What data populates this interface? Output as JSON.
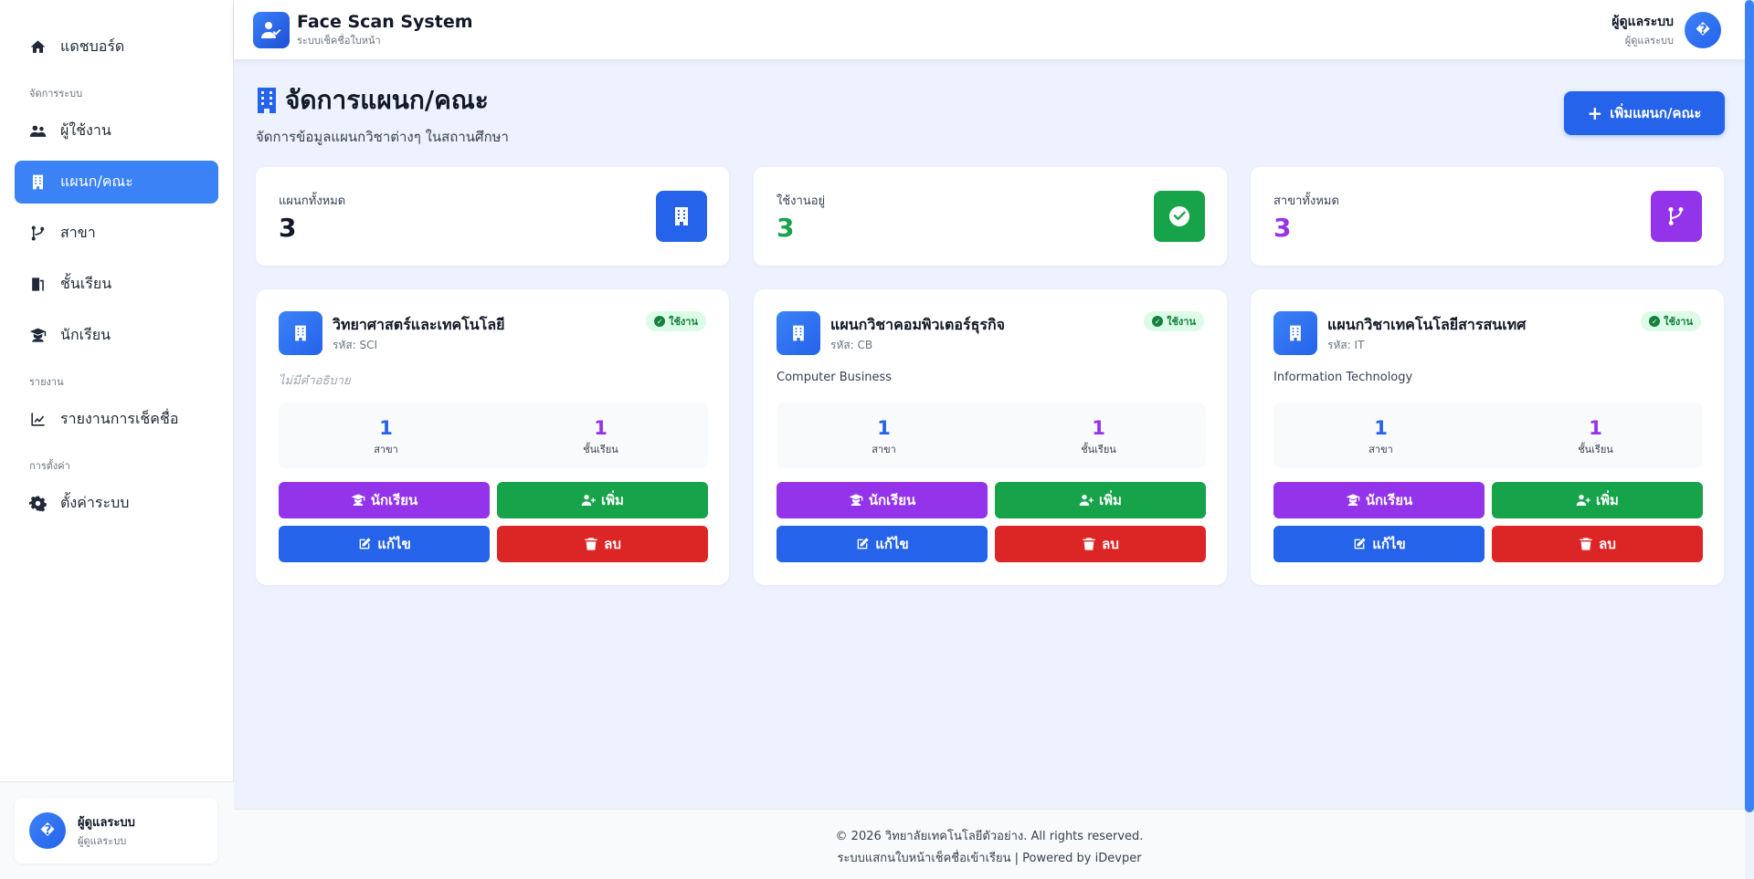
{
  "header": {
    "title": "Face Scan System",
    "subtitle": "ระบบเช็คชื่อใบหน้า",
    "user_name": "ผู้ดูแลระบบ",
    "user_role": "ผู้ดูแลระบบ",
    "avatar_glyph": "�"
  },
  "sidebar": {
    "items": [
      {
        "label": "แดชบอร์ด",
        "icon": "home-icon"
      },
      {
        "section": "จัดการระบบ"
      },
      {
        "label": "ผู้ใช้งาน",
        "icon": "users-icon"
      },
      {
        "label": "แผนก/คณะ",
        "icon": "building-icon",
        "active": true
      },
      {
        "label": "สาขา",
        "icon": "branch-icon"
      },
      {
        "label": "ชั้นเรียน",
        "icon": "door-icon"
      },
      {
        "label": "นักเรียน",
        "icon": "graduate-icon"
      },
      {
        "section": "รายงาน"
      },
      {
        "label": "รายงานการเช็คชื่อ",
        "icon": "chart-line-icon"
      },
      {
        "section": "การตั้งค่า"
      },
      {
        "label": "ตั้งค่าระบบ",
        "icon": "gear-icon"
      }
    ],
    "user_name": "ผู้ดูแลระบบ",
    "user_role": "ผู้ดูแลระบบ",
    "avatar_glyph": "�"
  },
  "page": {
    "title": "จัดการแผนก/คณะ",
    "subtitle": "จัดการข้อมูลแผนกวิชาต่างๆ ในสถานศึกษา",
    "add_button": "เพิ่มแผนก/คณะ"
  },
  "stats": [
    {
      "label": "แผนกทั้งหมด",
      "value": "3",
      "color": "#111827",
      "icon_bg": "#2563eb"
    },
    {
      "label": "ใช้งานอยู่",
      "value": "3",
      "color": "#16a34a",
      "icon_bg": "#16a34a"
    },
    {
      "label": "สาขาทั้งหมด",
      "value": "3",
      "color": "#9333ea",
      "icon_bg": "#9333ea"
    }
  ],
  "cards": [
    {
      "name": "วิทยาศาสตร์และเทคโนโลยี",
      "code": "รหัส: SCI",
      "status": "ใช้งาน",
      "description": "ไม่มีคำอธิบาย",
      "description_empty": true,
      "branches": "1",
      "branches_label": "สาขา",
      "classes": "1",
      "classes_label": "ชั้นเรียน"
    },
    {
      "name": "แผนกวิชาคอมพิวเตอร์ธุรกิจ",
      "code": "รหัส: CB",
      "status": "ใช้งาน",
      "description": "Computer Business",
      "description_empty": false,
      "branches": "1",
      "branches_label": "สาขา",
      "classes": "1",
      "classes_label": "ชั้นเรียน"
    },
    {
      "name": "แผนกวิชาเทคโนโลยีสารสนเทศ",
      "code": "รหัส: IT",
      "status": "ใช้งาน",
      "description": "Information Technology",
      "description_empty": false,
      "branches": "1",
      "branches_label": "สาขา",
      "classes": "1",
      "classes_label": "ชั้นเรียน"
    }
  ],
  "card_buttons": {
    "students": "นักเรียน",
    "add": "เพิ่ม",
    "edit": "แก้ไข",
    "delete": "ลบ"
  },
  "colors": {
    "primary": "#2563eb",
    "success": "#16a34a",
    "purple": "#9333ea",
    "danger": "#dc2626"
  },
  "footer": {
    "line1": "© 2026 วิทยาลัยเทคโนโลยีตัวอย่าง. All rights reserved.",
    "line2": "ระบบแสกนใบหน้าเช็คชื่อเข้าเรียน | Powered by iDevper"
  }
}
